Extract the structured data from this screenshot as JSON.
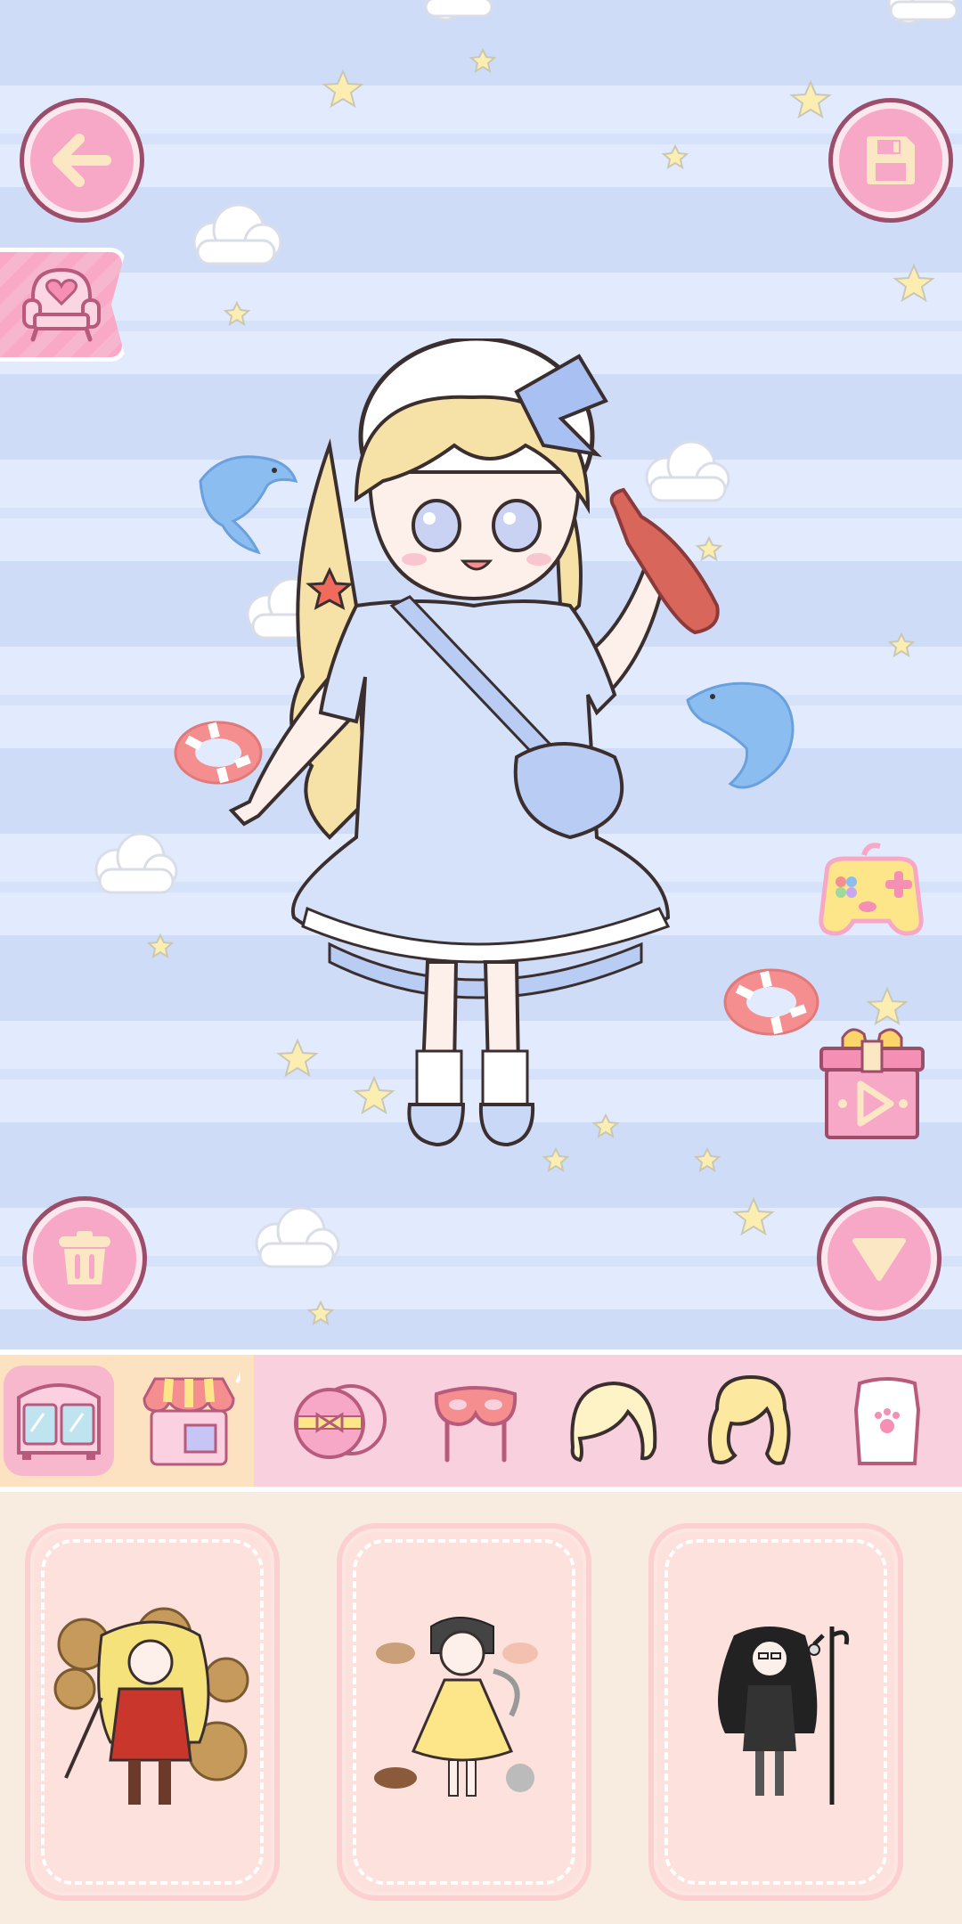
{
  "stage": {
    "colors": {
      "stripe_dark": "#cfdcf7",
      "stripe_light": "#e2ebfd",
      "button_pink": "#f7a8c6",
      "button_outline": "#9b4d6a"
    },
    "top_left_button": {
      "icon": "arrow-left-icon"
    },
    "top_right_button": {
      "icon": "save-disk-icon"
    },
    "side_tag": {
      "icon": "heart-sofa-icon"
    },
    "right_side_items": [
      {
        "icon": "gamepad-icon"
      },
      {
        "icon": "gift-video-icon"
      }
    ],
    "bottom_left_button": {
      "icon": "trash-icon"
    },
    "bottom_right_button": {
      "icon": "triangle-down-icon"
    },
    "character": {
      "description_icon": "doll-character"
    }
  },
  "category_bar": {
    "left_items": [
      {
        "icon": "wardrobe-icon",
        "active": true
      },
      {
        "icon": "shop-icon",
        "active": false
      }
    ],
    "items": [
      {
        "icon": "compact-mirror-icon"
      },
      {
        "icon": "eye-mask-icon"
      },
      {
        "icon": "short-hair-icon"
      },
      {
        "icon": "long-hair-icon"
      },
      {
        "icon": "shirt-icon"
      }
    ]
  },
  "outfit_cards": [
    {
      "icon": "steampunk-outfit-thumbnail"
    },
    {
      "icon": "yellow-dress-outfit-thumbnail"
    },
    {
      "icon": "black-gothic-outfit-thumbnail"
    }
  ]
}
